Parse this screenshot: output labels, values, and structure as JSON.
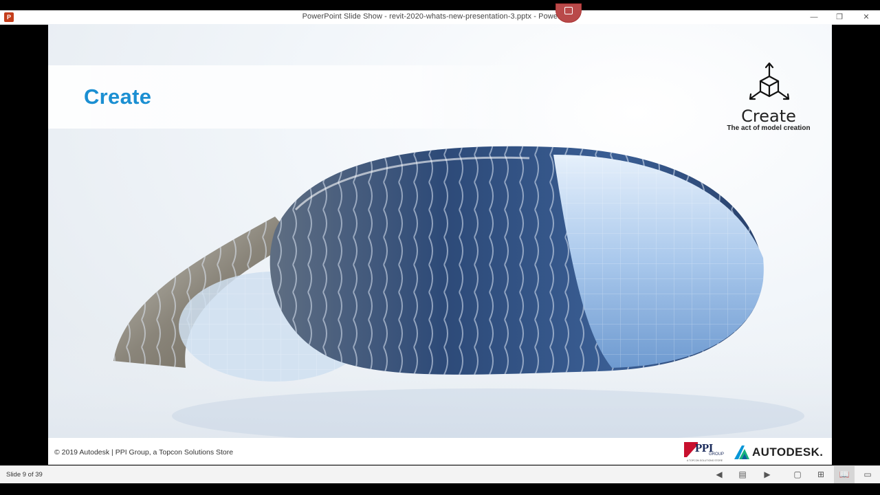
{
  "window": {
    "title": "PowerPoint Slide Show  -  revit-2020-whats-new-presentation-3.pptx - PowerPoint",
    "app_icon_letter": "P",
    "minimize_glyph": "—",
    "restore_glyph": "❐",
    "close_glyph": "✕"
  },
  "slide": {
    "title": "Create",
    "badge_heading": "Create",
    "badge_subtitle": "The act of model creation",
    "footer_text": "© 2019 Autodesk  |  PPI Group, a Topcon Solutions Store",
    "logos": {
      "ppi": "PPI",
      "ppi_group": "GROUP",
      "ppi_tagline": "A TOPCON SOLUTIONS STORE",
      "autodesk": "AUTODESK."
    },
    "colors": {
      "title": "#1b8fd2",
      "autodesk_blue": "#0696d7"
    }
  },
  "statusbar": {
    "slide_counter": "Slide 9 of 39",
    "buttons": [
      {
        "name": "previous-slide",
        "icon": "◀"
      },
      {
        "name": "slide-notes",
        "icon": "▤"
      },
      {
        "name": "next-slide",
        "icon": "▶"
      },
      {
        "name": "normal-view",
        "icon": "▢"
      },
      {
        "name": "slide-sorter-view",
        "icon": "⊞"
      },
      {
        "name": "reading-view",
        "icon": "📖"
      },
      {
        "name": "slide-show-view",
        "icon": "▭"
      }
    ]
  }
}
